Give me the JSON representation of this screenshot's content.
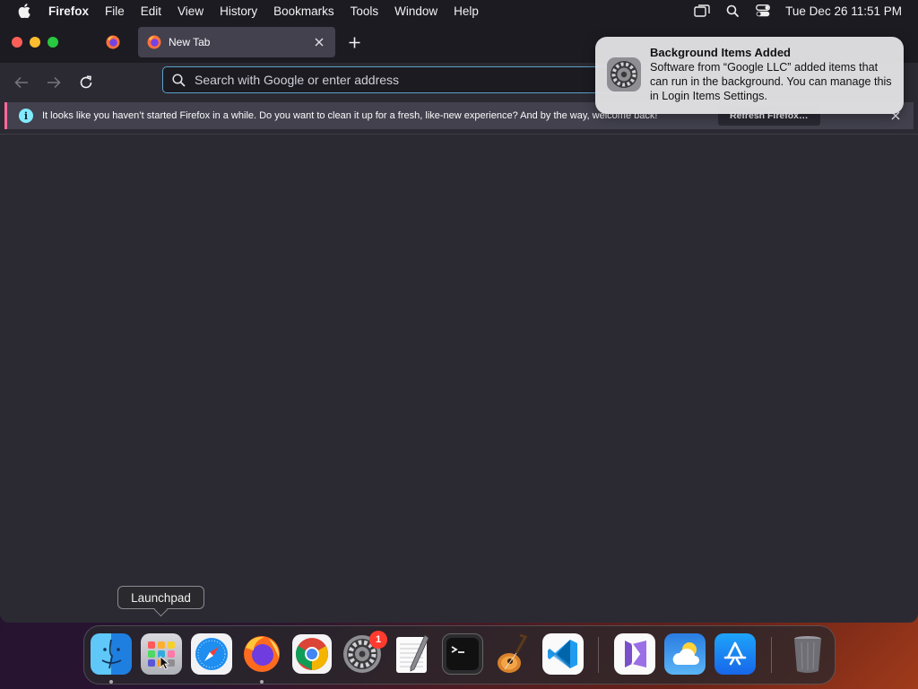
{
  "menubar": {
    "app_name": "Firefox",
    "items": [
      "File",
      "Edit",
      "View",
      "History",
      "Bookmarks",
      "Tools",
      "Window",
      "Help"
    ],
    "clock": "Tue Dec 26  11:51 PM"
  },
  "browser": {
    "tab": {
      "title": "New Tab"
    },
    "urlbar": {
      "placeholder": "Search with Google or enter address"
    },
    "infobar": {
      "message": "It looks like you haven’t started Firefox in a while. Do you want to clean it up for a fresh, like-new experience? And by the way, welcome back!",
      "button": "Refresh Firefox…"
    }
  },
  "notification": {
    "title": "Background Items Added",
    "body": "Software from “Google LLC” added items that can run in the background. You can manage this in Login Items Settings."
  },
  "dock": {
    "tooltip": "Launchpad",
    "settings_badge": "1",
    "apps": [
      "finder",
      "launchpad",
      "safari",
      "firefox",
      "chrome",
      "system-settings",
      "textedit",
      "terminal",
      "garageband",
      "vscode",
      "visual-studio",
      "weather",
      "app-store",
      "trash"
    ]
  },
  "colors": {
    "window_bg": "#2b2a33",
    "tabbar_bg": "#1c1b22",
    "infobar_accent": "#ff6a9a",
    "urlbar_focus": "#5aa1c8"
  }
}
